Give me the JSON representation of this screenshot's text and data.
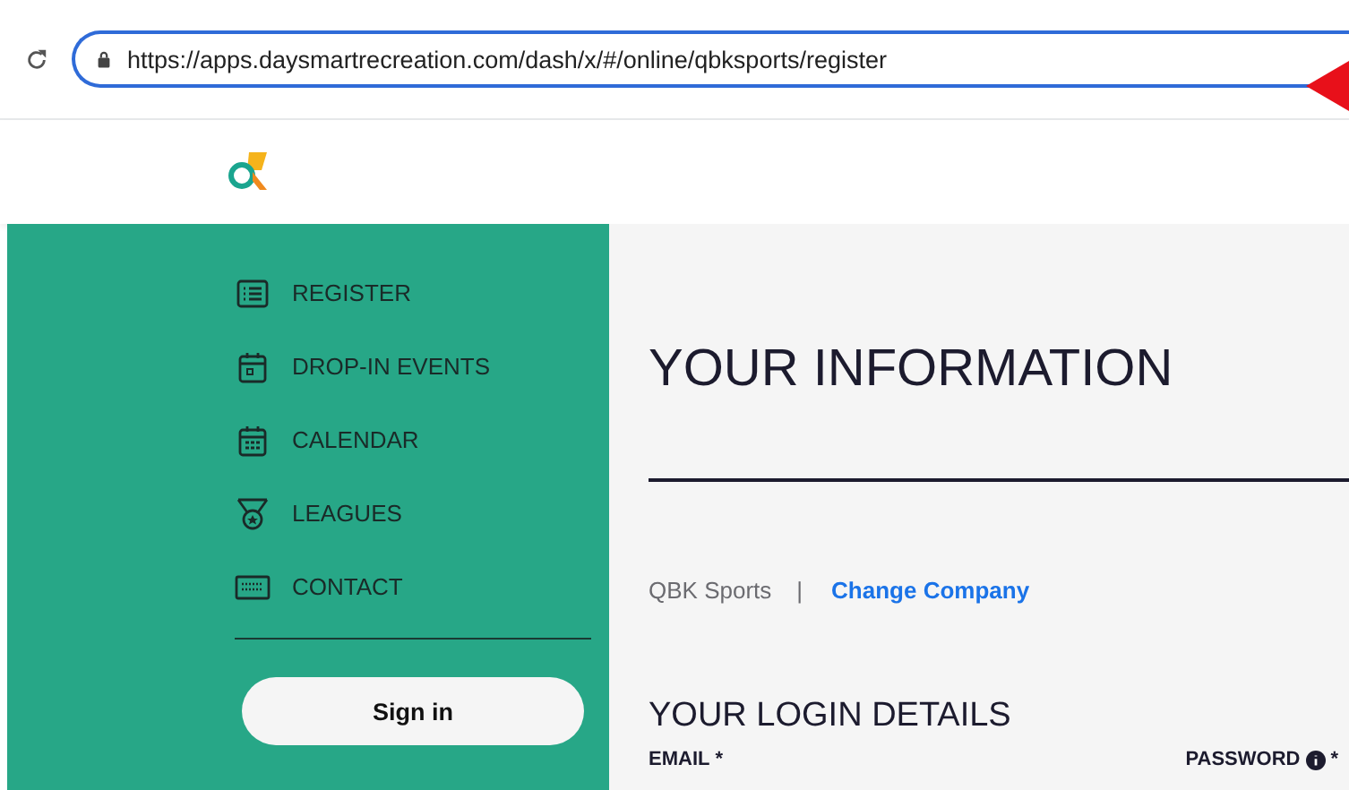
{
  "browser": {
    "url": "https://apps.daysmartrecreation.com/dash/x/#/online/qbksports/register"
  },
  "sidebar": {
    "items": [
      {
        "label": "REGISTER",
        "kind": "list"
      },
      {
        "label": "DROP-IN EVENTS",
        "kind": "event"
      },
      {
        "label": "CALENDAR",
        "kind": "calendar"
      },
      {
        "label": "LEAGUES",
        "kind": "medal"
      },
      {
        "label": "CONTACT",
        "kind": "keyboard"
      }
    ],
    "sign_in": "Sign in"
  },
  "main": {
    "title": "YOUR INFORMATION",
    "company": "QBK Sports",
    "separator": "|",
    "change_company": "Change Company",
    "section": "YOUR LOGIN DETAILS",
    "fields": [
      {
        "label": "EMAIL",
        "required": "*"
      },
      {
        "label": "PASSWORD",
        "required": "*",
        "info": true
      }
    ]
  }
}
